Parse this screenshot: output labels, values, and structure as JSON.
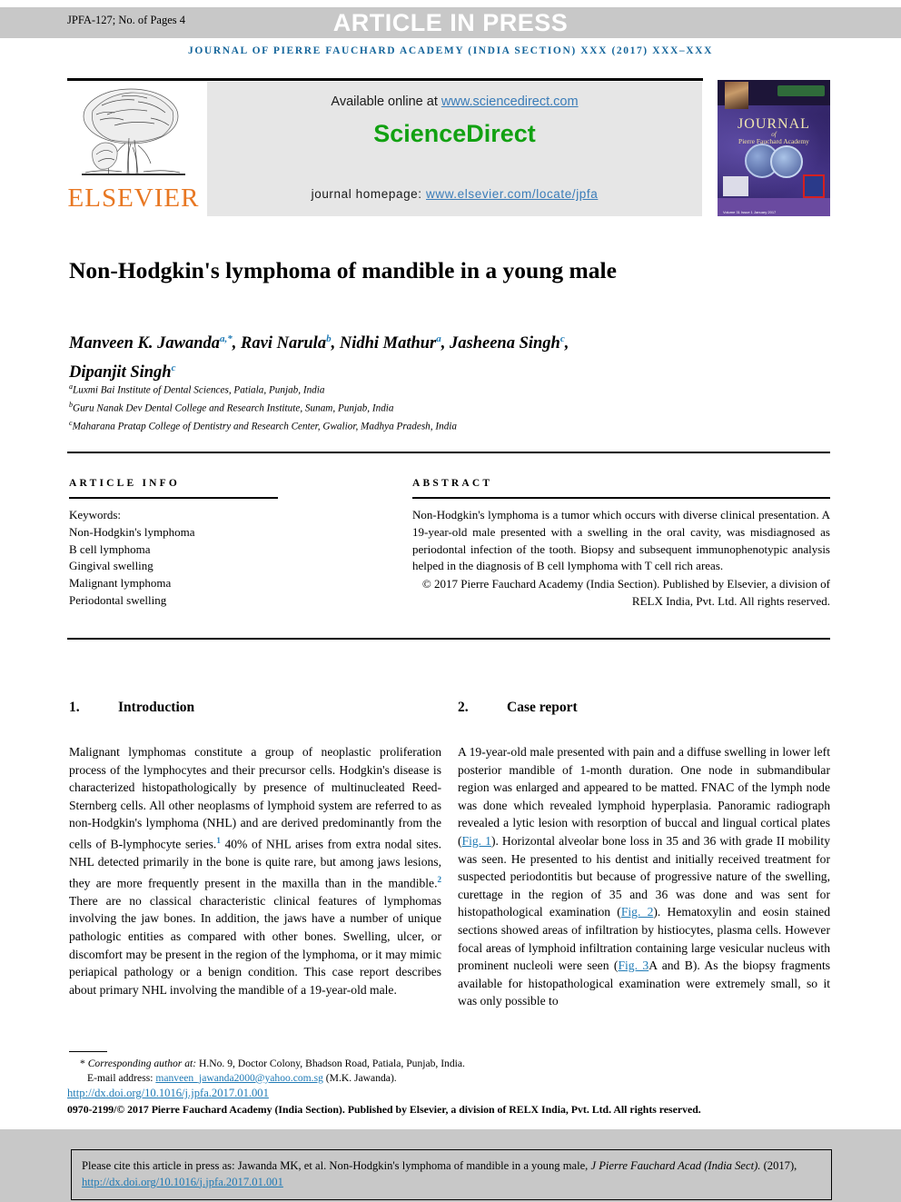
{
  "banner": {
    "jpfa_code": "JPFA-127; No. of Pages 4",
    "article_in_press": "ARTICLE IN PRESS",
    "journal_line": "JOURNAL OF PIERRE FAUCHARD ACADEMY (INDIA SECTION) XXX (2017) XXX–XXX"
  },
  "masthead": {
    "elsevier_wordmark": "ELSEVIER",
    "available_prefix": "Available online at ",
    "available_link": "www.sciencedirect.com",
    "sciencedirect_logo": "ScienceDirect",
    "homepage_prefix": "journal homepage: ",
    "homepage_link": "www.elsevier.com/locate/jpfa",
    "cover": {
      "title": "JOURNAL",
      "of": "of",
      "subtitle": "Pierre Fauchard Academy",
      "volume_block": "Volume 31\nIssue 1\nJanuary 2017"
    }
  },
  "article": {
    "title": "Non-Hodgkin's lymphoma of mandible in a young male",
    "authors_line1": "Manveen K. Jawanda",
    "authors": [
      {
        "name": "Manveen K. Jawanda",
        "sup": "a,*"
      },
      {
        "name": "Ravi Narula",
        "sup": "b"
      },
      {
        "name": "Nidhi Mathur",
        "sup": "a"
      },
      {
        "name": "Jasheena Singh",
        "sup": "c"
      },
      {
        "name": "Dipanjit Singh",
        "sup": "c"
      }
    ],
    "affiliations": [
      {
        "marker": "a",
        "text": "Luxmi Bai Institute of Dental Sciences, Patiala, Punjab, India"
      },
      {
        "marker": "b",
        "text": "Guru Nanak Dev Dental College and Research Institute, Sunam, Punjab, India"
      },
      {
        "marker": "c",
        "text": "Maharana Pratap College of Dentistry and Research Center, Gwalior, Madhya Pradesh, India"
      }
    ]
  },
  "info_section": {
    "article_info_heading": "ARTICLE INFO",
    "abstract_heading": "ABSTRACT",
    "keywords_label": "Keywords:",
    "keywords": [
      "Non-Hodgkin's lymphoma",
      "B cell lymphoma",
      "Gingival swelling",
      "Malignant lymphoma",
      "Periodontal swelling"
    ],
    "abstract_text": "Non-Hodgkin's lymphoma is a tumor which occurs with diverse clinical presentation. A 19-year-old male presented with a swelling in the oral cavity, was misdiagnosed as periodontal infection of the tooth. Biopsy and subsequent immunophenotypic analysis helped in the diagnosis of B cell lymphoma with T cell rich areas.",
    "abstract_copyright": "© 2017 Pierre Fauchard Academy (India Section). Published by Elsevier, a division of RELX India, Pvt. Ltd. All rights reserved."
  },
  "sections": {
    "introduction": {
      "number": "1.",
      "heading": "Introduction",
      "paragraph_a": "Malignant lymphomas constitute a group of neoplastic proliferation process of the lymphocytes and their precursor cells. Hodgkin's disease is characterized histopathologically by presence of multinucleated Reed-Sternberg cells. All other neoplasms of lymphoid system are referred to as non-Hodgkin's lymphoma (NHL) and are derived predominantly from the cells of B-lymphocyte series.",
      "ref1": "1",
      "paragraph_b": " 40% of NHL arises from extra nodal sites. NHL detected primarily in the bone is quite rare, but among jaws lesions, they are more frequently present in the maxilla than in the mandible.",
      "ref2": "2",
      "paragraph_c": " There are no classical characteristic clinical features of lymphomas involving the jaw bones. In addition, the jaws have a number of unique pathologic entities as compared with other bones. Swelling, ulcer, or discomfort may be present in the region of the lymphoma, or it may mimic periapical pathology or a benign condition. This case report describes about primary NHL involving the mandible of a 19-year-old male."
    },
    "case_report": {
      "number": "2.",
      "heading": "Case report",
      "part_a": "A 19-year-old male presented with pain and a diffuse swelling in lower left posterior mandible of 1-month duration. One node in submandibular region was enlarged and appeared to be matted. FNAC of the lymph node was done which revealed lymphoid hyperplasia. Panoramic radiograph revealed a lytic lesion with resorption of buccal and lingual cortical plates (",
      "fig1": "Fig. 1",
      "part_b": "). Horizontal alveolar bone loss in 35 and 36 with grade II mobility was seen. He presented to his dentist and initially received treatment for suspected periodontitis but because of progressive nature of the swelling, curettage in the region of 35 and 36 was done and was sent for histopathological examination (",
      "fig2": "Fig. 2",
      "part_c": "). Hematoxylin and eosin stained sections showed areas of infiltration by histiocytes, plasma cells. However focal areas of lymphoid infiltration containing large vesicular nucleus with prominent nucleoli were seen (",
      "fig3": "Fig. 3",
      "part_d": "A and B). As the biopsy fragments available for histopathological examination were extremely small, so it was only possible to"
    }
  },
  "footer": {
    "corresponding_star": "*",
    "corresponding_label": "Corresponding author at:",
    "corresponding_address": " H.No. 9, Doctor Colony, Bhadson Road, Patiala, Punjab, India.",
    "email_label": "E-mail address: ",
    "email_link": "manveen_jawanda2000@yahoo.com.sg",
    "email_suffix": " (M.K. Jawanda).",
    "doi": "http://dx.doi.org/10.1016/j.jpfa.2017.01.001",
    "issn_line": "0970-2199/© 2017 Pierre Fauchard Academy (India Section). Published by Elsevier, a division of RELX India, Pvt. Ltd. All rights reserved."
  },
  "citation_box": {
    "prefix": "Please cite this article in press as: Jawanda MK, et al. Non-Hodgkin's lymphoma of mandible in a young male, ",
    "journal_italic": "J Pierre Fauchard Acad (India Sect).",
    "year": " (2017), ",
    "doi_link": "http://dx.doi.org/10.1016/j.jpfa.2017.01.001"
  },
  "colors": {
    "journal_blue": "#14659b",
    "link_blue": "#1f7ab5",
    "sciencedirect_green": "#12a112",
    "elsevier_orange": "#e87722",
    "banner_gray": "#c8c8c8",
    "sd_box_gray": "#e6e6e6"
  }
}
